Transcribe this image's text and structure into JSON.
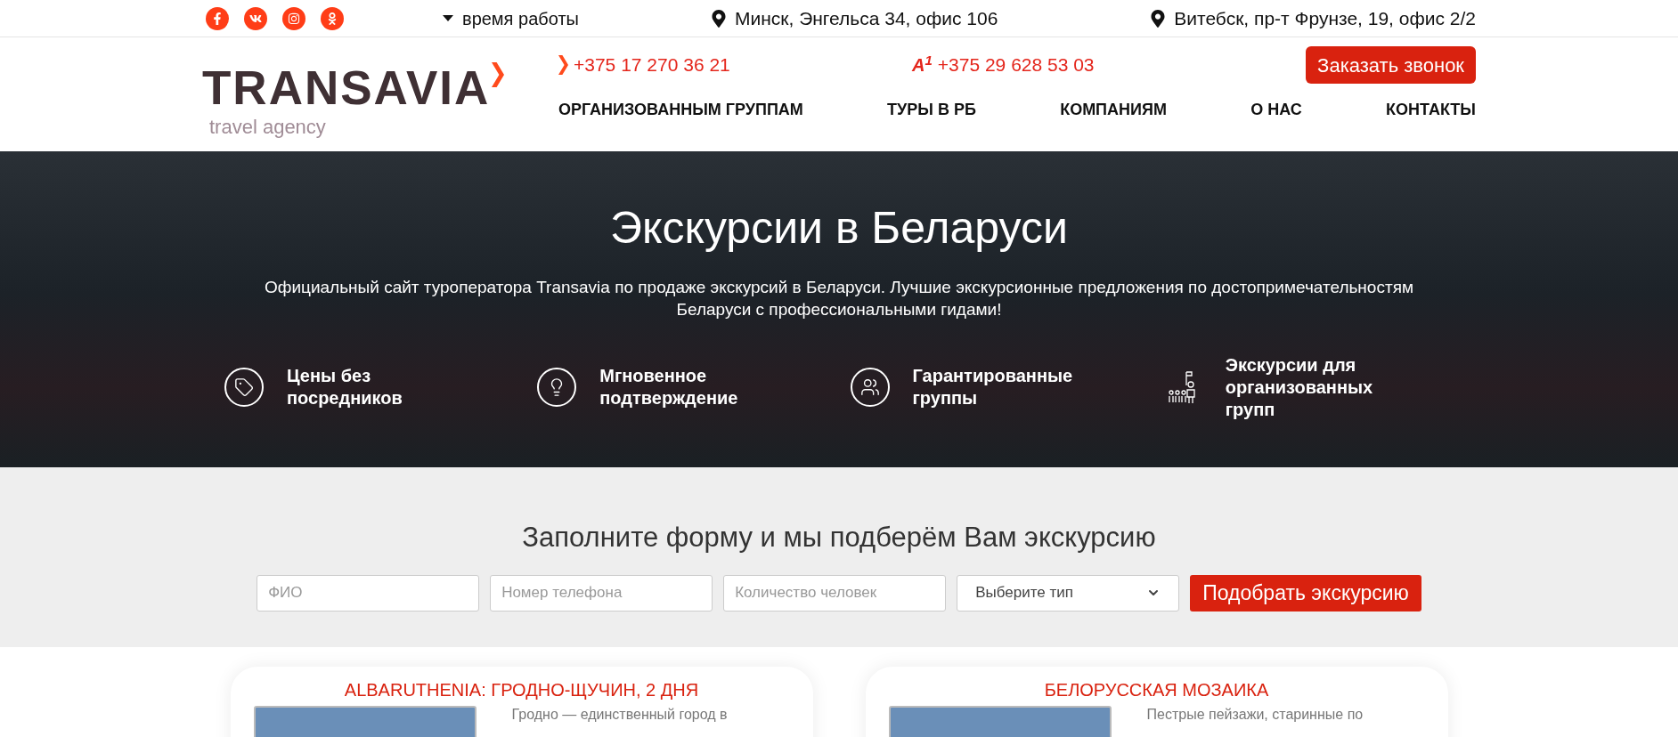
{
  "top_bar": {
    "socials": [
      {
        "kind": "facebook"
      },
      {
        "kind": "vk"
      },
      {
        "kind": "instagram"
      },
      {
        "kind": "odnoklassniki"
      }
    ],
    "hours": "время работы",
    "addresses": [
      "Минск, Энгельса 34, офис 106",
      "Витебск, пр-т Фрунзе, 19, офис 2/2"
    ]
  },
  "header": {
    "logo": {
      "name": "TRANSAVIA",
      "tagline": "travel agency"
    },
    "phones": [
      {
        "kind": "chevron",
        "number": "+375 17 270 36 21"
      },
      {
        "kind": "operator",
        "operator_mark": "A$^{1}$",
        "number": "+375 29 628 53 03"
      }
    ],
    "callback_button": "Заказать звонок",
    "nav": [
      "ОРГАНИЗОВАННЫМ ГРУППАМ",
      "ТУРЫ В РБ",
      "КОМПАНИЯМ",
      "О НАС",
      "КОНТАКТЫ"
    ]
  },
  "hero": {
    "title": "Экскурсии в Беларуси",
    "text": "Официальный сайт туроператора Transavia по продаже экскурсий в Беларуси. Лучшие экскурсионные предложения по достопримечательностям Беларуси с профессиональными гидами!",
    "features": [
      {
        "kind": "tag",
        "label": "Цены без посредников"
      },
      {
        "kind": "bulb",
        "label": "Мгновенное подтверждение"
      },
      {
        "kind": "people",
        "label": "Гарантированные группы"
      },
      {
        "kind": "group",
        "label": "Экскурсии для организованных групп"
      }
    ]
  },
  "form": {
    "title": "Заполните форму и мы подберём Вам экскурсию",
    "fields": [
      {
        "placeholder": "ФИО"
      },
      {
        "placeholder": "Номер телефона"
      },
      {
        "placeholder": "Количество человек"
      }
    ],
    "select": {
      "value": "Выберите тип"
    },
    "submit": "Подобрать экскурсию"
  },
  "tours": [
    {
      "title": "ALBARUTHENIA: ГРОДНО-ЩУЧИН, 2 ДНЯ",
      "text": "Гродно — единственный город в"
    },
    {
      "title": "БЕЛОРУССКАЯ МОЗАИКА",
      "text": "Пестрые пейзажи, старинные по"
    }
  ]
}
